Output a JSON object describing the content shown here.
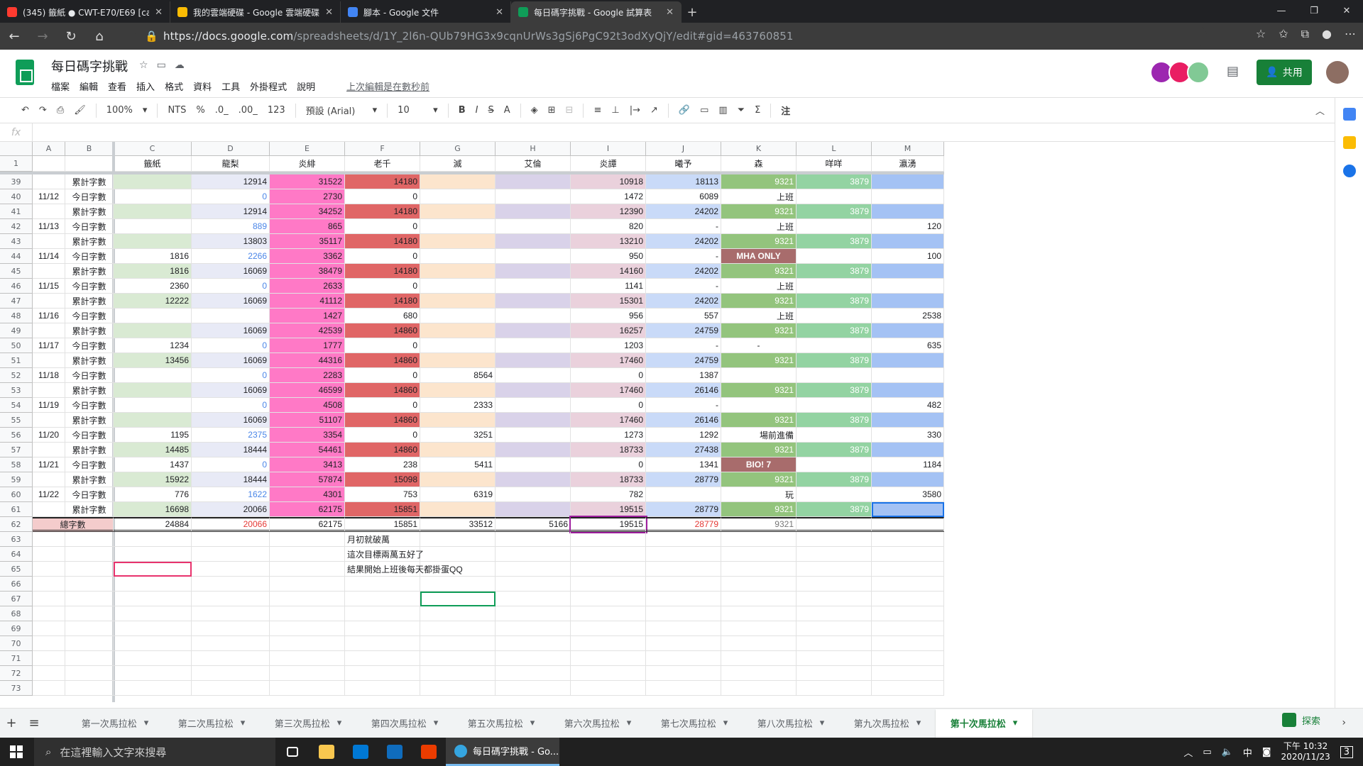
{
  "browser": {
    "tabs": [
      {
        "label": "(345) 籤紙 ● CWT-E70/E69 [canc",
        "color": "#ff3b30",
        "active": false
      },
      {
        "label": "我的雲端硬碟 - Google 雲端硬碟",
        "color": "#fbbc04",
        "active": false
      },
      {
        "label": "腳本 - Google 文件",
        "color": "#4285f4",
        "active": false
      },
      {
        "label": "每日碼字挑戰 - Google 試算表",
        "color": "#0f9d58",
        "active": true
      }
    ],
    "url_main": "https://docs.google.com",
    "url_rest": "/spreadsheets/d/1Y_2l6n-QUb79HG3x9cqnUrWs3gSj6PgC92t3odXyQjY/edit#gid=463760851"
  },
  "doc": {
    "title": "每日碼字挑戰",
    "menus": [
      "檔案",
      "編輯",
      "查看",
      "插入",
      "格式",
      "資料",
      "工具",
      "外掛程式",
      "說明"
    ],
    "last_edit": "上次編輯是在數秒前",
    "share": "共用"
  },
  "toolbar": {
    "zoom": "100%",
    "currency": "NTS",
    "percent": "%",
    "dec0": ".0_",
    "dec00": ".00_",
    "fmt": "123",
    "font": "預設 (Arial)",
    "size": "10"
  },
  "fx": "fx",
  "columns": [
    {
      "letter": "A",
      "head": ""
    },
    {
      "letter": "B",
      "head": ""
    },
    {
      "letter": "C",
      "head": "籤紙"
    },
    {
      "letter": "D",
      "head": "龍梨"
    },
    {
      "letter": "E",
      "head": "炎緋"
    },
    {
      "letter": "F",
      "head": "老千"
    },
    {
      "letter": "G",
      "head": "滅"
    },
    {
      "letter": "H",
      "head": "艾倫"
    },
    {
      "letter": "I",
      "head": "炎譚"
    },
    {
      "letter": "J",
      "head": "曦予"
    },
    {
      "letter": "K",
      "head": "森"
    },
    {
      "letter": "L",
      "head": "咩咩"
    },
    {
      "letter": "M",
      "head": "瀛湧"
    }
  ],
  "rows": [
    {
      "n": "39",
      "cells": [
        "",
        "累計字數",
        "",
        "12914",
        "31522",
        "14180",
        "",
        "",
        "10918",
        "18113",
        "9321",
        "3879",
        ""
      ]
    },
    {
      "n": "40",
      "cells": [
        "11/12",
        "今日字數",
        "",
        "0",
        "2730",
        "0",
        "",
        "",
        "1472",
        "6089",
        "上班",
        "",
        ""
      ]
    },
    {
      "n": "41",
      "cells": [
        "",
        "累計字數",
        "",
        "12914",
        "34252",
        "14180",
        "",
        "",
        "12390",
        "24202",
        "9321",
        "3879",
        ""
      ]
    },
    {
      "n": "42",
      "cells": [
        "11/13",
        "今日字數",
        "",
        "889",
        "865",
        "0",
        "",
        "",
        "820",
        "-",
        "上班",
        "",
        "120"
      ]
    },
    {
      "n": "43",
      "cells": [
        "",
        "累計字數",
        "",
        "13803",
        "35117",
        "14180",
        "",
        "",
        "13210",
        "24202",
        "9321",
        "3879",
        ""
      ]
    },
    {
      "n": "44",
      "cells": [
        "11/14",
        "今日字數",
        "1816",
        "2266",
        "3362",
        "0",
        "",
        "",
        "950",
        "-",
        "MHA ONLY",
        "",
        "100"
      ]
    },
    {
      "n": "45",
      "cells": [
        "",
        "累計字數",
        "1816",
        "16069",
        "38479",
        "14180",
        "",
        "",
        "14160",
        "24202",
        "9321",
        "3879",
        ""
      ]
    },
    {
      "n": "46",
      "cells": [
        "11/15",
        "今日字數",
        "2360",
        "0",
        "2633",
        "0",
        "",
        "",
        "1141",
        "-",
        "上班",
        "",
        ""
      ]
    },
    {
      "n": "47",
      "cells": [
        "",
        "累計字數",
        "12222",
        "16069",
        "41112",
        "14180",
        "",
        "",
        "15301",
        "24202",
        "9321",
        "3879",
        ""
      ]
    },
    {
      "n": "48",
      "cells": [
        "11/16",
        "今日字數",
        "",
        "",
        "1427",
        "680",
        "",
        "",
        "956",
        "557",
        "上班",
        "",
        "2538"
      ]
    },
    {
      "n": "49",
      "cells": [
        "",
        "累計字數",
        "",
        "16069",
        "42539",
        "14860",
        "",
        "",
        "16257",
        "24759",
        "9321",
        "3879",
        ""
      ]
    },
    {
      "n": "50",
      "cells": [
        "11/17",
        "今日字數",
        "1234",
        "0",
        "1777",
        "0",
        "",
        "",
        "1203",
        "-",
        "-",
        "",
        "635"
      ]
    },
    {
      "n": "51",
      "cells": [
        "",
        "累計字數",
        "13456",
        "16069",
        "44316",
        "14860",
        "",
        "",
        "17460",
        "24759",
        "9321",
        "3879",
        ""
      ]
    },
    {
      "n": "52",
      "cells": [
        "11/18",
        "今日字數",
        "",
        "0",
        "2283",
        "0",
        "8564",
        "",
        "0",
        "1387",
        "",
        "",
        ""
      ]
    },
    {
      "n": "53",
      "cells": [
        "",
        "累計字數",
        "",
        "16069",
        "46599",
        "14860",
        "",
        "",
        "17460",
        "26146",
        "9321",
        "3879",
        ""
      ]
    },
    {
      "n": "54",
      "cells": [
        "11/19",
        "今日字數",
        "",
        "0",
        "4508",
        "0",
        "2333",
        "",
        "0",
        "-",
        "",
        "",
        "482"
      ]
    },
    {
      "n": "55",
      "cells": [
        "",
        "累計字數",
        "",
        "16069",
        "51107",
        "14860",
        "",
        "",
        "17460",
        "26146",
        "9321",
        "3879",
        ""
      ]
    },
    {
      "n": "56",
      "cells": [
        "11/20",
        "今日字數",
        "1195",
        "2375",
        "3354",
        "0",
        "3251",
        "",
        "1273",
        "1292",
        "場前進備",
        "",
        "330"
      ]
    },
    {
      "n": "57",
      "cells": [
        "",
        "累計字數",
        "14485",
        "18444",
        "54461",
        "14860",
        "",
        "",
        "18733",
        "27438",
        "9321",
        "3879",
        ""
      ]
    },
    {
      "n": "58",
      "cells": [
        "11/21",
        "今日字數",
        "1437",
        "0",
        "3413",
        "238",
        "5411",
        "",
        "0",
        "1341",
        "BIO! 7",
        "",
        "1184"
      ]
    },
    {
      "n": "59",
      "cells": [
        "",
        "累計字數",
        "15922",
        "18444",
        "57874",
        "15098",
        "",
        "",
        "18733",
        "28779",
        "9321",
        "3879",
        ""
      ]
    },
    {
      "n": "60",
      "cells": [
        "11/22",
        "今日字數",
        "776",
        "1622",
        "4301",
        "753",
        "6319",
        "",
        "782",
        "",
        "玩",
        "",
        "3580"
      ]
    },
    {
      "n": "61",
      "cells": [
        "",
        "累計字數",
        "16698",
        "20066",
        "62175",
        "15851",
        "",
        "",
        "19515",
        "28779",
        "9321",
        "3879",
        ""
      ]
    },
    {
      "n": "62",
      "cells": [
        "總字數",
        "",
        "24884",
        "20066",
        "62175",
        "15851",
        "33512",
        "5166",
        "19515",
        "28779",
        "9321",
        "",
        ""
      ]
    },
    {
      "n": "63",
      "cells": [
        "",
        "",
        "",
        "",
        "",
        "月初就破萬",
        "",
        "",
        "",
        "",
        "",
        "",
        ""
      ]
    },
    {
      "n": "64",
      "cells": [
        "",
        "",
        "",
        "",
        "",
        "這次目標兩萬五好了",
        "",
        "",
        "",
        "",
        "",
        "",
        ""
      ]
    },
    {
      "n": "65",
      "cells": [
        "",
        "",
        "",
        "",
        "",
        "結果開始上班後每天都掛蛋QQ",
        "",
        "",
        "",
        "",
        "",
        "",
        ""
      ]
    },
    {
      "n": "66",
      "cells": [
        "",
        "",
        "",
        "",
        "",
        "",
        "",
        "",
        "",
        "",
        "",
        "",
        ""
      ]
    },
    {
      "n": "67",
      "cells": [
        "",
        "",
        "",
        "",
        "",
        "",
        "",
        "",
        "",
        "",
        "",
        "",
        ""
      ]
    },
    {
      "n": "68",
      "cells": [
        "",
        "",
        "",
        "",
        "",
        "",
        "",
        "",
        "",
        "",
        "",
        "",
        ""
      ]
    },
    {
      "n": "69",
      "cells": [
        "",
        "",
        "",
        "",
        "",
        "",
        "",
        "",
        "",
        "",
        "",
        "",
        ""
      ]
    },
    {
      "n": "70",
      "cells": [
        "",
        "",
        "",
        "",
        "",
        "",
        "",
        "",
        "",
        "",
        "",
        "",
        ""
      ]
    },
    {
      "n": "71",
      "cells": [
        "",
        "",
        "",
        "",
        "",
        "",
        "",
        "",
        "",
        "",
        "",
        "",
        ""
      ]
    },
    {
      "n": "72",
      "cells": [
        "",
        "",
        "",
        "",
        "",
        "",
        "",
        "",
        "",
        "",
        "",
        "",
        ""
      ]
    },
    {
      "n": "73",
      "cells": [
        "",
        "",
        "",
        "",
        "",
        "",
        "",
        "",
        "",
        "",
        "",
        "",
        ""
      ]
    }
  ],
  "colors": {
    "C": "#d9ead3",
    "D": "#e8eaf6",
    "E": "#ff79c6",
    "F": "#e06666",
    "G": "#fce5cd",
    "H": "#d9d2e9",
    "I": "#ead1dc",
    "J": "#c9daf8",
    "K": "#93c47d",
    "L": "#93d3a2",
    "M": "#a4c2f4",
    "K_special": "#a86c6c",
    "total_label": "#f4cccc",
    "blue_text": "#4a86e8",
    "red_text": "#e53935"
  },
  "sheet_tabs": [
    "第一次馬拉松",
    "第二次馬拉松",
    "第三次馬拉松",
    "第四次馬拉松",
    "第五次馬拉松",
    "第六次馬拉松",
    "第七次馬拉松",
    "第八次馬拉松",
    "第九次馬拉松",
    "第十次馬拉松"
  ],
  "active_sheet": "第十次馬拉松",
  "explore": "探索",
  "taskbar": {
    "search": "在這裡輸入文字來搜尋",
    "active_app": "每日碼字挑戰 - Go...",
    "ime": "中",
    "time": "下午 10:32",
    "date": "2020/11/23",
    "notif": "3"
  }
}
